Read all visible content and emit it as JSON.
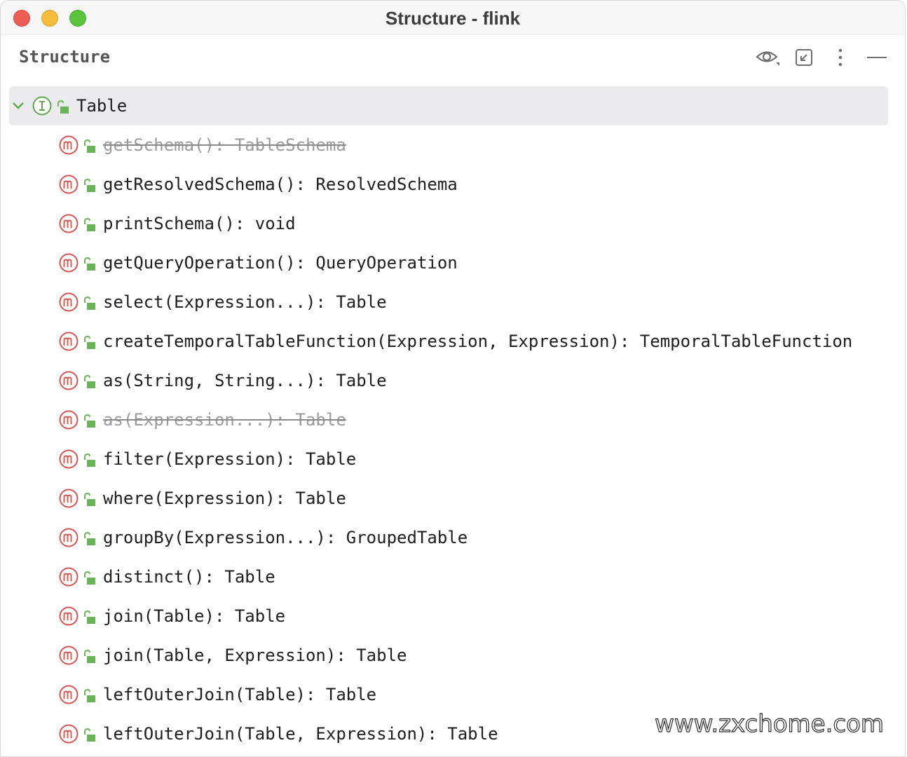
{
  "window": {
    "title": "Structure - flink"
  },
  "panel": {
    "title": "Structure",
    "icons": [
      "eye-icon",
      "collapse-icon",
      "more-options-icon",
      "minimize-icon"
    ]
  },
  "tree": {
    "root": {
      "label": "Table",
      "kind": "interface",
      "expanded": true
    },
    "items": [
      {
        "label": "getSchema(): TableSchema",
        "deprecated": true
      },
      {
        "label": "getResolvedSchema(): ResolvedSchema",
        "deprecated": false
      },
      {
        "label": "printSchema(): void",
        "deprecated": false
      },
      {
        "label": "getQueryOperation(): QueryOperation",
        "deprecated": false
      },
      {
        "label": "select(Expression...): Table",
        "deprecated": false
      },
      {
        "label": "createTemporalTableFunction(Expression, Expression): TemporalTableFunction",
        "deprecated": false
      },
      {
        "label": "as(String, String...): Table",
        "deprecated": false
      },
      {
        "label": "as(Expression...): Table",
        "deprecated": true
      },
      {
        "label": "filter(Expression): Table",
        "deprecated": false
      },
      {
        "label": "where(Expression): Table",
        "deprecated": false
      },
      {
        "label": "groupBy(Expression...): GroupedTable",
        "deprecated": false
      },
      {
        "label": "distinct(): Table",
        "deprecated": false
      },
      {
        "label": "join(Table): Table",
        "deprecated": false
      },
      {
        "label": "join(Table, Expression): Table",
        "deprecated": false
      },
      {
        "label": "leftOuterJoin(Table): Table",
        "deprecated": false
      },
      {
        "label": "leftOuterJoin(Table, Expression): Table",
        "deprecated": false
      }
    ]
  },
  "watermark": "www.zxchome.com",
  "colors": {
    "method_badge": "#d9534f",
    "interface_badge": "#5fa84f",
    "lock": "#6bb35a",
    "selection": "#ebebee"
  }
}
